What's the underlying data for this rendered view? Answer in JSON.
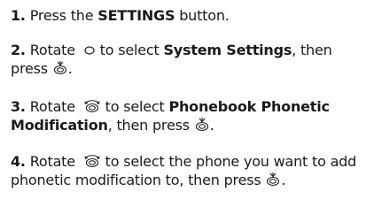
{
  "steps": [
    {
      "number": "1.",
      "text_a": "Press the ",
      "bold_a": "SETTINGS",
      "text_b": " button."
    },
    {
      "number": "2.",
      "text_a": "Rotate ",
      "icon_a": "interface-dial-icon",
      "text_b": " to select ",
      "bold_a": "System Settings",
      "text_c": ", then press ",
      "icon_b": "press-interface-dial-icon",
      "text_d": "."
    },
    {
      "number": "3.",
      "text_a": "Rotate ",
      "icon_a": "rotate-interface-dial-icon",
      "text_b": " to select ",
      "bold_a": "Phonebook Phonetic Modification",
      "text_c": ", then press ",
      "icon_b": "press-interface-dial-icon",
      "text_d": "."
    },
    {
      "number": "4.",
      "text_a": "Rotate ",
      "icon_a": "rotate-interface-dial-icon",
      "text_b": " to select the phone you want to add phonetic modification to, then press ",
      "icon_b": "press-interface-dial-icon",
      "text_c": "."
    }
  ]
}
